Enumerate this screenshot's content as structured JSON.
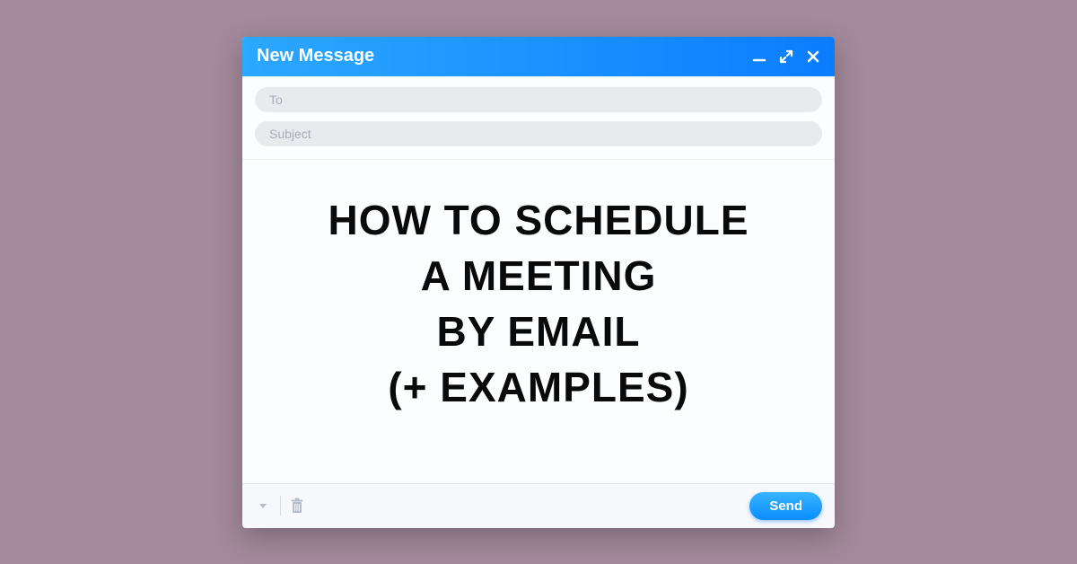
{
  "window": {
    "title": "New Message",
    "icons": {
      "minimize": "minimize-icon",
      "expand": "expand-icon",
      "close": "close-icon"
    }
  },
  "fields": {
    "to_placeholder": "To",
    "subject_placeholder": "Subject"
  },
  "body": {
    "headline": "HOW TO SCHEDULE\nA MEETING\nBY EMAIL\n(+ EXAMPLES)"
  },
  "footer": {
    "send_label": "Send"
  },
  "colors": {
    "background": "#a3899b",
    "header_gradient_start": "#2ba8ff",
    "header_gradient_end": "#0a7dff",
    "pill_bg": "#e8eaee",
    "pill_text": "#a9adb6"
  }
}
